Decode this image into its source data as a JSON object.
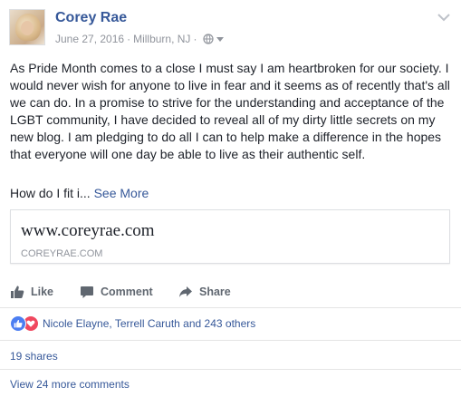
{
  "post": {
    "author": "Corey Rae",
    "date": "June 27, 2016",
    "separator": "·",
    "location": "Millburn, NJ",
    "location_separator": "·",
    "text": "As Pride Month comes to a close I must say I am heartbroken for our society. I would never wish for anyone to live in fear and it seems as of recently that's all we can do. In a promise to strive for the understanding and acceptance of the LGBT community, I have decided to reveal all of my dirty little secrets on my new blog. I am pledging to do all I can to help make a difference in the hopes that everyone will one day be able to live as their authentic self.",
    "truncated_text": "How do I fit i...",
    "see_more": "See More"
  },
  "link_preview": {
    "title": "www.coreyrae.com",
    "domain": "COREYRAE.COM"
  },
  "actions": {
    "like": "Like",
    "comment": "Comment",
    "share": "Share"
  },
  "reactions": {
    "summary": "Nicole Elayne, Terrell Caruth and 243 others",
    "icons": [
      "like-reaction-icon",
      "love-reaction-icon"
    ]
  },
  "shares": "19 shares",
  "comments_link": "View 24 more comments",
  "colors": {
    "link_blue": "#365899",
    "secondary_text": "#90949c",
    "action_text": "#606770",
    "like_blue": "#4c7ef2",
    "love_red": "#f0485f"
  }
}
